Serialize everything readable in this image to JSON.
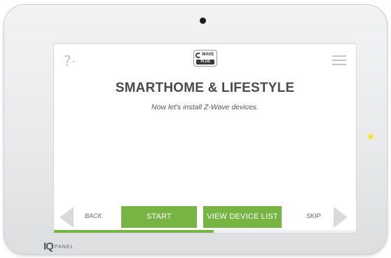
{
  "device": {
    "brand_mark": "IQ",
    "brand_name": "PANEL"
  },
  "header": {
    "help_label": "?",
    "badge": {
      "word": "WAVE",
      "sub": "PLUS"
    }
  },
  "main": {
    "title": "SMARTHOME & LIFESTYLE",
    "subtitle": "Now let's install Z-Wave devices."
  },
  "nav": {
    "back_label": "BACK",
    "skip_label": "SKIP",
    "start_label": "START",
    "view_list_label": "VIEW DEVICE LIST"
  },
  "progress": {
    "fraction": 0.53
  },
  "colors": {
    "accent": "#76b544",
    "title_text": "#4a4a4a",
    "led": "#f2e21b"
  },
  "icons": {
    "help": "question-mark-icon",
    "menu": "hamburger-menu-icon",
    "back": "left-arrow-icon",
    "skip": "right-arrow-icon",
    "badge": "zwave-plus-logo"
  }
}
